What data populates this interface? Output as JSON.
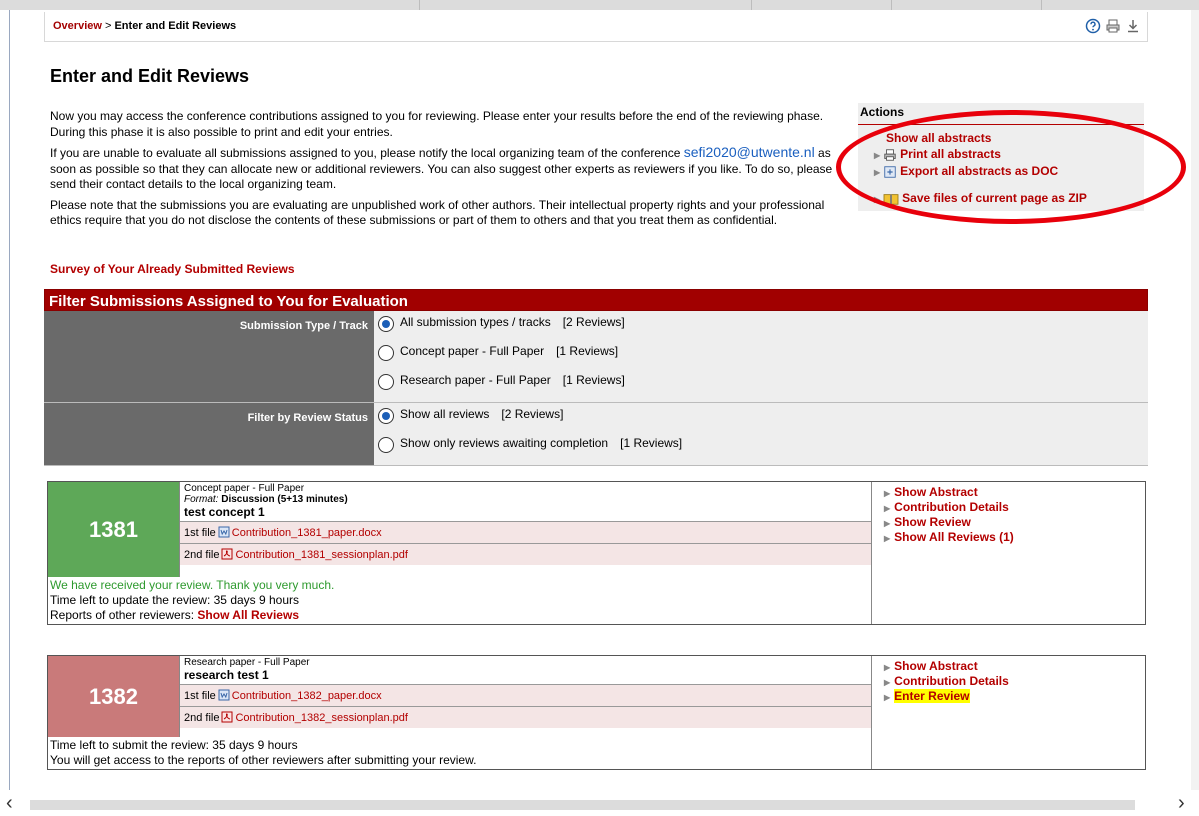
{
  "breadcrumb": {
    "link": "Overview",
    "separator": " > ",
    "current": "Enter and Edit Reviews"
  },
  "page_title": "Enter and Edit Reviews",
  "intro": {
    "p1": "Now you may access the conference contributions assigned to you for reviewing. Please enter your results before the end of the reviewing phase. During this phase it is also possible to print and edit your entries.",
    "p2_before": "If you are unable to evaluate all submissions assigned to you, please notify the local organizing team of the conference ",
    "p2_email": "sefi2020@utwente.nl",
    "p2_after": " as soon as possible so that they can allocate new or additional reviewers. You can also suggest other experts as reviewers if you like. To do so, please send their contact details to the local organizing team.",
    "p3": "Please note that the submissions you are evaluating are unpublished work of other authors. Their intellectual property rights and your professional ethics require that you do not disclose the contents of these submissions or part of them to others and that you treat them as confidential."
  },
  "survey_link": "Survey of Your Already Submitted Reviews",
  "actions": {
    "title": "Actions",
    "show_all": "Show all abstracts",
    "print_all": "Print all abstracts",
    "export_doc": "Export all abstracts as DOC",
    "save_zip": "Save files of current page as ZIP"
  },
  "filter": {
    "heading": "Filter Submissions Assigned to You for Evaluation",
    "type_label": "Submission Type / Track",
    "type_options": [
      {
        "label": "All submission types / tracks",
        "count": "[2 Reviews]",
        "selected": true
      },
      {
        "label": "Concept paper - Full Paper",
        "count": "[1 Reviews]",
        "selected": false
      },
      {
        "label": "Research paper - Full Paper",
        "count": "[1 Reviews]",
        "selected": false
      }
    ],
    "status_label": "Filter by Review Status",
    "status_options": [
      {
        "label": "Show all reviews",
        "count": "[2 Reviews]",
        "selected": true
      },
      {
        "label": "Show only reviews awaiting completion",
        "count": "[1 Reviews]",
        "selected": false
      }
    ]
  },
  "submissions": [
    {
      "id": "1381",
      "color": "#5ea858",
      "type": "Concept paper - Full Paper",
      "format_label": "Format:",
      "format_value": "Discussion (5+13 minutes)",
      "title": "test concept 1",
      "file1_label": "1st file",
      "file1_name": "Contribution_1381_paper.docx",
      "file2_label": "2nd file",
      "file2_name": "Contribution_1381_sessionplan.pdf",
      "links": [
        "Show Abstract",
        "Contribution Details",
        "Show Review",
        "Show All Reviews (1)"
      ],
      "received": "We have received your review. Thank you very much.",
      "time_left": "Time left to update the review: 35 days 9 hours",
      "reports_label": "Reports of other reviewers:",
      "reports_link": "Show All Reviews"
    },
    {
      "id": "1382",
      "color": "#c97a7a",
      "type": "Research paper - Full Paper",
      "title": "research test 1",
      "file1_label": "1st file",
      "file1_name": "Contribution_1382_paper.docx",
      "file2_label": "2nd file",
      "file2_name": "Contribution_1382_sessionplan.pdf",
      "links": [
        "Show Abstract",
        "Contribution Details",
        "Enter Review"
      ],
      "time_left": "Time left to submit the review: 35 days 9 hours",
      "access_note": "You will get access to the reports of other reviewers after submitting your review."
    }
  ],
  "colors": {
    "accent_red": "#b30000",
    "header_red": "#a10000",
    "highlight": "#ffff00",
    "annotation_oval": "#e8000b"
  },
  "icons": [
    "help-icon",
    "print-icon",
    "download-icon",
    "arrow-left-icon",
    "arrow-right-icon",
    "docx-file-icon",
    "pdf-file-icon",
    "zip-icon",
    "export-doc-icon"
  ]
}
